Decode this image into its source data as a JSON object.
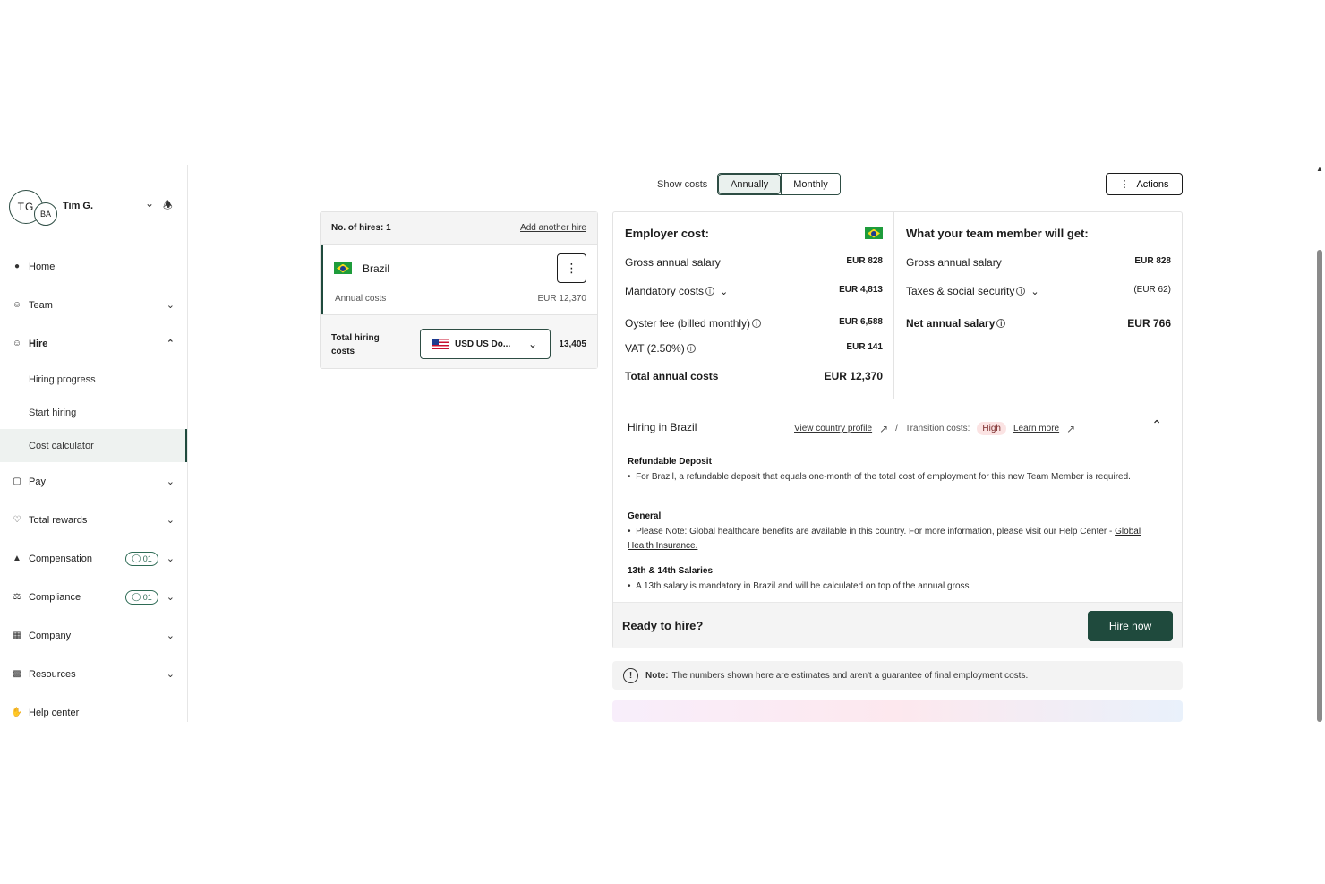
{
  "user": {
    "initials_primary": "TG",
    "initials_secondary": "BA",
    "name": "Tim G."
  },
  "nav": {
    "home": "Home",
    "team": "Team",
    "hire": "Hire",
    "hire_sub": [
      "Hiring progress",
      "Start hiring",
      "Cost calculator"
    ],
    "pay": "Pay",
    "total_rewards": "Total rewards",
    "compensation": "Compensation",
    "compensation_badge": "01",
    "compliance": "Compliance",
    "compliance_badge": "01",
    "company": "Company",
    "resources": "Resources",
    "help_center": "Help center"
  },
  "controls": {
    "show_costs_label": "Show costs",
    "annually": "Annually",
    "monthly": "Monthly",
    "selected_period": "Annually",
    "actions": "Actions"
  },
  "hires": {
    "count_label": "No. of hires: 1",
    "add_another": "Add another hire",
    "country": "Brazil",
    "annual_costs_label": "Annual costs",
    "annual_costs_value": "EUR 12,370",
    "total_label": "Total hiring costs",
    "currency": "USD US Do...",
    "total_value": "13,405"
  },
  "employer": {
    "title": "Employer cost:",
    "gross_label": "Gross annual salary",
    "gross_value": "EUR 828",
    "mandatory_label": "Mandatory costs",
    "mandatory_value": "EUR 4,813",
    "oyster_label": "Oyster fee (billed monthly)",
    "oyster_value": "EUR 6,588",
    "vat_label": "VAT (2.50%)",
    "vat_value": "EUR 141",
    "total_label": "Total annual costs",
    "total_value": "EUR 12,370"
  },
  "member": {
    "title": "What your team member will get:",
    "gross_label": "Gross annual salary",
    "gross_value": "EUR 828",
    "taxes_label": "Taxes & social security",
    "taxes_value": "(EUR 62)",
    "net_label": "Net annual salary",
    "net_value": "EUR 766"
  },
  "hiring_info": {
    "title": "Hiring in Brazil",
    "view_profile": "View country profile",
    "separator": "/",
    "transition_label": "Transition costs:",
    "transition_value": "High",
    "learn_more": "Learn more",
    "deposit_title": "Refundable Deposit",
    "deposit_text": "For Brazil, a refundable deposit that equals one-month of the total cost of employment for this new Team Member is required.",
    "general_title": "General",
    "general_text": "Please Note: Global healthcare benefits are available in this country. For more information, please visit our Help Center - ",
    "general_link": "Global Health Insurance.",
    "salaries_title": "13th & 14th Salaries",
    "salaries_text": "A 13th salary is mandatory in Brazil and will be calculated on top of the annual gross"
  },
  "ready": {
    "label": "Ready to hire?",
    "button": "Hire now"
  },
  "note": {
    "label": "Note:",
    "text": "The numbers shown here are estimates and aren't a guarantee of final employment costs."
  },
  "colors": {
    "brand": "#1f4a3d",
    "active_nav_bg": "#eef2f0",
    "high_badge_bg": "#fbe3e3"
  },
  "icons": {
    "home": "home-icon",
    "team": "team-icon",
    "hire": "hire-icon",
    "pay": "pay-icon",
    "total_rewards": "heart-icon",
    "compensation": "chart-icon",
    "compliance": "scale-icon",
    "company": "building-icon",
    "resources": "folder-icon",
    "help_center": "help-icon"
  }
}
